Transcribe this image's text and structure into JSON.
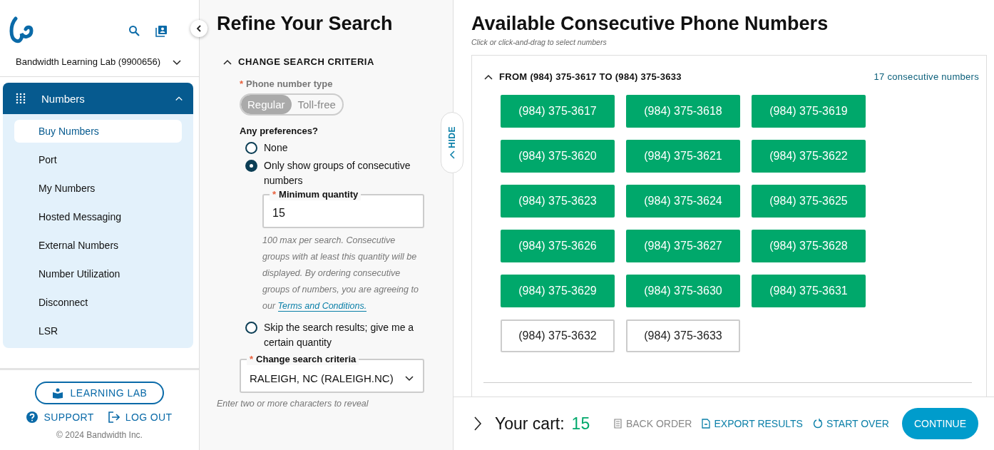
{
  "sidebar": {
    "account": "Bandwidth Learning Lab (9900656)",
    "nav": {
      "label": "Numbers",
      "expanded": true,
      "items": [
        {
          "label": "Buy Numbers",
          "selected": true
        },
        {
          "label": "Port",
          "selected": false
        },
        {
          "label": "My Numbers",
          "selected": false
        },
        {
          "label": "Hosted Messaging",
          "selected": false
        },
        {
          "label": "External Numbers",
          "selected": false
        },
        {
          "label": "Number Utilization",
          "selected": false
        },
        {
          "label": "Disconnect",
          "selected": false
        },
        {
          "label": "LSR",
          "selected": false
        }
      ]
    },
    "learning_lab": "LEARNING LAB",
    "support": "SUPPORT",
    "logout": "LOG OUT",
    "copyright": "© 2024 Bandwidth Inc."
  },
  "refine": {
    "title": "Refine Your Search",
    "section": "CHANGE SEARCH CRITERIA",
    "expanded": true,
    "type_label": "Phone number type",
    "type_required": "*",
    "types": [
      {
        "label": "Regular",
        "selected": true
      },
      {
        "label": "Toll-free",
        "selected": false
      }
    ],
    "pref_label": "Any preferences?",
    "options": [
      {
        "label": "None",
        "selected": false
      },
      {
        "label": "Only show groups of consecutive numbers",
        "selected": true
      },
      {
        "label": "Skip the search results; give me a certain quantity",
        "selected": false
      }
    ],
    "min_label": "Minimum quantity",
    "min_required": "*",
    "min_value": "15",
    "help": "100 max per search. Consecutive groups with at least this quantity will be displayed. By ordering consecutive groups of numbers, you are agreeing to our",
    "terms": "Terms and Conditions.",
    "criteria_label": "Change search criteria",
    "criteria_required": "*",
    "criteria_value": "RALEIGH, NC (RALEIGH.NC)",
    "criteria_hint": "Enter two or more characters to reveal",
    "hide": "HIDE"
  },
  "results": {
    "title": "Available Consecutive Phone Numbers",
    "subtitle": "Click or click-and-drag to select numbers",
    "group": {
      "label": "FROM (984) 375-3617 TO (984) 375-3633",
      "count": "17 consecutive numbers",
      "expanded": true,
      "numbers": [
        {
          "label": "(984) 375-3617",
          "selected": true
        },
        {
          "label": "(984) 375-3618",
          "selected": true
        },
        {
          "label": "(984) 375-3619",
          "selected": true
        },
        {
          "label": "(984) 375-3620",
          "selected": true
        },
        {
          "label": "(984) 375-3621",
          "selected": true
        },
        {
          "label": "(984) 375-3622",
          "selected": true
        },
        {
          "label": "(984) 375-3623",
          "selected": true
        },
        {
          "label": "(984) 375-3624",
          "selected": true
        },
        {
          "label": "(984) 375-3625",
          "selected": true
        },
        {
          "label": "(984) 375-3626",
          "selected": true
        },
        {
          "label": "(984) 375-3627",
          "selected": true
        },
        {
          "label": "(984) 375-3628",
          "selected": true
        },
        {
          "label": "(984) 375-3629",
          "selected": true
        },
        {
          "label": "(984) 375-3630",
          "selected": true
        },
        {
          "label": "(984) 375-3631",
          "selected": true
        },
        {
          "label": "(984) 375-3632",
          "selected": false
        },
        {
          "label": "(984) 375-3633",
          "selected": false
        }
      ]
    }
  },
  "cart": {
    "label": "Your cart:",
    "count": "15",
    "expanded": false,
    "actions": [
      {
        "label": "BACK ORDER",
        "kind": "backorder",
        "disabled": true
      },
      {
        "label": "EXPORT RESULTS",
        "kind": "export",
        "disabled": false
      },
      {
        "label": "START OVER",
        "kind": "restart",
        "disabled": false
      }
    ],
    "continue": "CONTINUE"
  }
}
